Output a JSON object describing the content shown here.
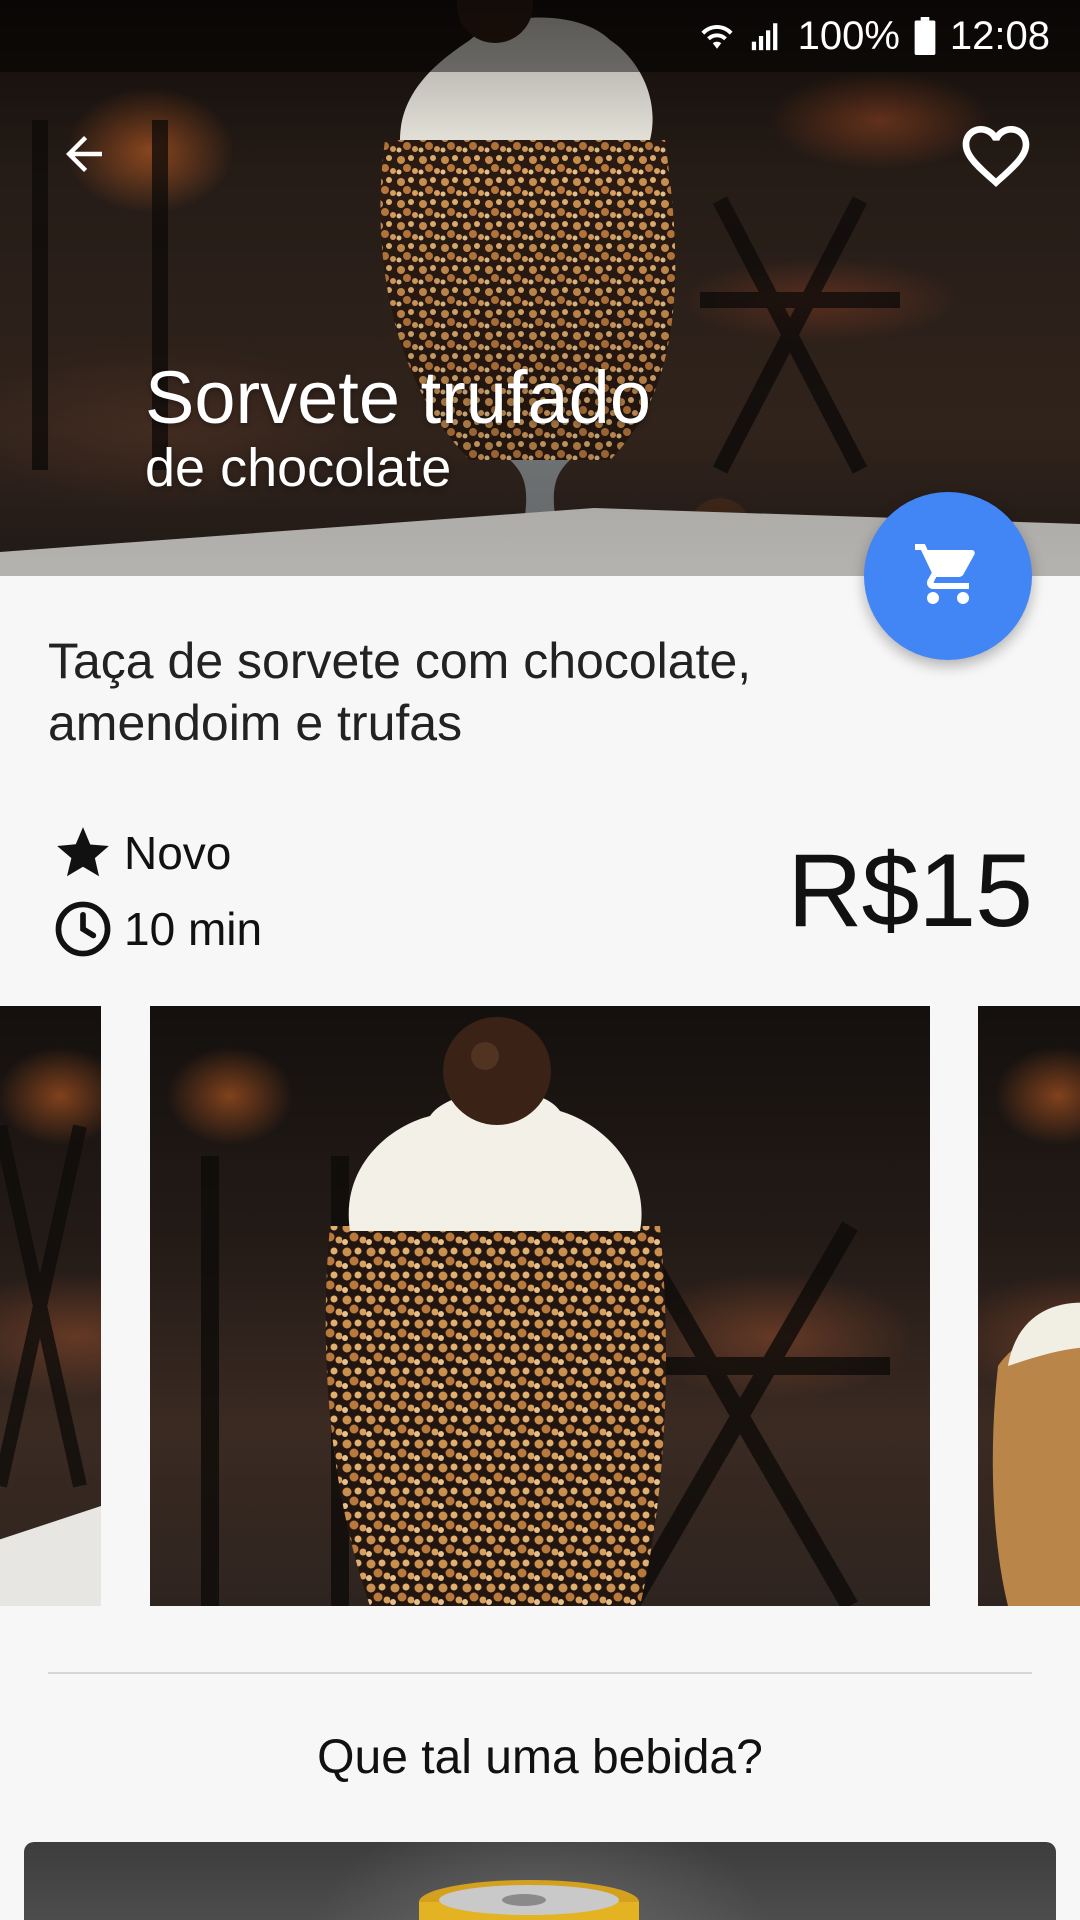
{
  "status_bar": {
    "battery": "100%",
    "time": "12:08"
  },
  "product": {
    "title": "Sorvete trufado",
    "subtitle": "de chocolate",
    "description": "Taça de sorvete com chocolate, amendoim e trufas",
    "tag": "Novo",
    "prep_time": "10 min",
    "price": "R$15"
  },
  "suggestions": {
    "title": "Que tal uma bebida?"
  },
  "colors": {
    "accent": "#4285f4",
    "text": "#111111",
    "background": "#f7f7f7"
  },
  "icons": {
    "back": "arrow-back-icon",
    "favorite": "heart-outline-icon",
    "cart": "shopping-cart-icon",
    "tag": "star-icon",
    "time": "clock-icon"
  }
}
